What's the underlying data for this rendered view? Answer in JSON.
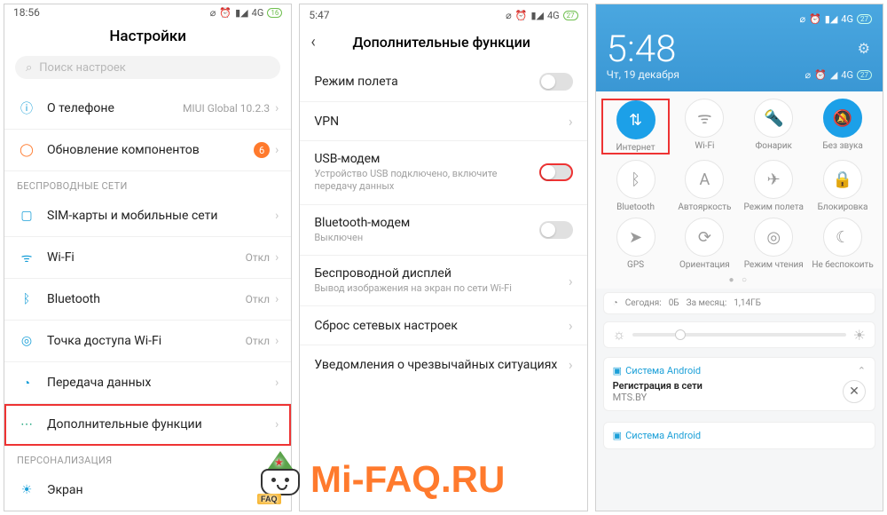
{
  "panel1": {
    "status_time": "18:56",
    "status_net": "4G",
    "status_batt": "16",
    "title": "Настройки",
    "search_placeholder": "Поиск настроек",
    "about_label": "О телефоне",
    "about_value": "MIUI Global 10.2.3",
    "update_label": "Обновление компонентов",
    "update_badge": "6",
    "section_wireless": "БЕСПРОВОДНЫЕ СЕТИ",
    "sim_label": "SIM-карты и мобильные сети",
    "wifi_label": "Wi-Fi",
    "wifi_value": "Откл",
    "bt_label": "Bluetooth",
    "bt_value": "Откл",
    "hotspot_label": "Точка доступа Wi-Fi",
    "hotspot_value": "Откл",
    "data_label": "Передача данных",
    "more_label": "Дополнительные функции",
    "section_personal": "ПЕРСОНАЛИЗАЦИЯ",
    "display_label": "Экран"
  },
  "panel2": {
    "status_time": "5:47",
    "status_net": "4G",
    "status_batt": "27",
    "title": "Дополнительные функции",
    "airplane_label": "Режим полета",
    "vpn_label": "VPN",
    "usb_label": "USB-модем",
    "usb_sub": "Устройство USB подключено, включите передачу данных",
    "btm_label": "Bluetooth-модем",
    "btm_sub": "Выключен",
    "cast_label": "Беспроводной дисплей",
    "cast_sub": "Вывод изображения на экран по сети Wi-Fi",
    "reset_label": "Сброс сетевых настроек",
    "alerts_label": "Уведомления о чрезвычайных ситуациях"
  },
  "panel3": {
    "time": "5:48",
    "date": "Чт, 19 декабря",
    "status_net": "4G",
    "status_batt": "27",
    "tiles": [
      {
        "label": "Интернет",
        "icon": "⇅",
        "active": true
      },
      {
        "label": "Wi-Fi",
        "icon": "ᯤ",
        "active": false
      },
      {
        "label": "Фонарик",
        "icon": "🔦",
        "active": false
      },
      {
        "label": "Без звука",
        "icon": "🔕",
        "active": true
      },
      {
        "label": "Bluetooth",
        "icon": "ᛒ",
        "active": false
      },
      {
        "label": "Автояркость",
        "icon": "A",
        "active": false
      },
      {
        "label": "Режим полета",
        "icon": "✈",
        "active": false
      },
      {
        "label": "Блокировка",
        "icon": "🔒",
        "active": false
      },
      {
        "label": "GPS",
        "icon": "➤",
        "active": false
      },
      {
        "label": "Ориентация",
        "icon": "⟳",
        "active": false
      },
      {
        "label": "Режим чтения",
        "icon": "◎",
        "active": false
      },
      {
        "label": "Не беспокоить",
        "icon": "☾",
        "active": false
      }
    ],
    "usage_today_lbl": "Сегодня:",
    "usage_today_val": "0Б",
    "usage_month_lbl": "За месяц:",
    "usage_month_val": "1,14ГБ",
    "notif1_head": "Система Android",
    "notif1_title": "Регистрация в сети",
    "notif1_body": "MTS.BY",
    "notif2_head": "Система Android"
  },
  "watermark": "Mi-FAQ.RU",
  "mascot_tag": "FAQ"
}
